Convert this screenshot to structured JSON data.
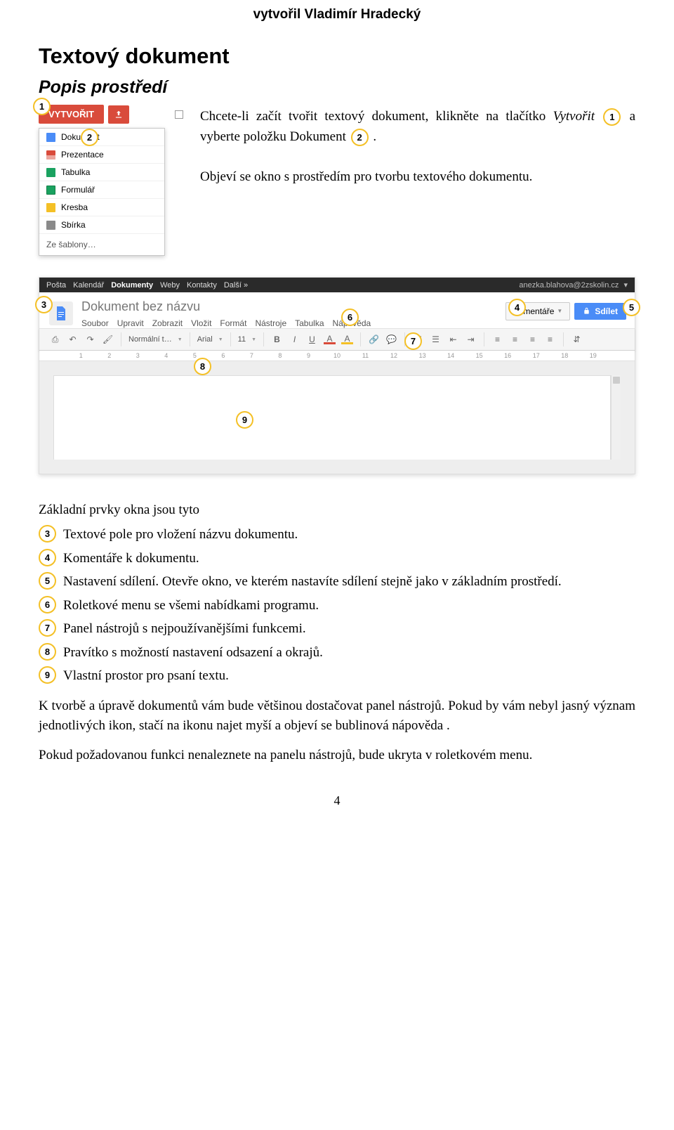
{
  "author": "vytvořil Vladimír Hradecký",
  "title": "Textový dokument",
  "subtitle": "Popis prostředí",
  "intro": {
    "line1_a": "Chcete-li začít tvořit textový dokument, klikněte na tlačítko",
    "vytvorit_word": "Vytvořit",
    "line1_b": " a vyberte položku Dokument ",
    "period": ".",
    "line2": "Objeví se okno s prostředím pro tvorbu textového dokumentu."
  },
  "markers": {
    "intro_left": "1",
    "intro_inline1": "1",
    "intro_inline2": "2",
    "create_item": "2",
    "docs_title": "3",
    "docs_comments": "4",
    "docs_share": "5",
    "docs_menu": "6",
    "docs_toolbar": "7",
    "docs_ruler": "8",
    "docs_body": "9"
  },
  "create_menu": {
    "button": "VYTVOŘIT",
    "items": [
      {
        "label": "Dokument",
        "icon": "ci-doc"
      },
      {
        "label": "Prezentace",
        "icon": "ci-pres"
      },
      {
        "label": "Tabulka",
        "icon": "ci-tab"
      },
      {
        "label": "Formulář",
        "icon": "ci-form"
      },
      {
        "label": "Kresba",
        "icon": "ci-draw"
      },
      {
        "label": "Sbírka",
        "icon": "ci-coll"
      }
    ],
    "from_template": "Ze šablony…"
  },
  "docs": {
    "blackbar": {
      "items": [
        "Pošta",
        "Kalendář",
        "Dokumenty",
        "Weby",
        "Kontakty",
        "Další »"
      ],
      "bold_index": 2,
      "user": "anezka.blahova@2zskolin.cz",
      "arrow": "▾"
    },
    "untitled": "Dokument bez názvu",
    "menubar": [
      "Soubor",
      "Upravit",
      "Zobrazit",
      "Vložit",
      "Formát",
      "Nástroje",
      "Tabulka",
      "Nápověda"
    ],
    "comments_btn": "Komentáře",
    "share_btn": "Sdílet",
    "toolbar": {
      "style": "Normální t…",
      "font": "Arial",
      "size": "11"
    },
    "ruler_max": 19
  },
  "legend": {
    "intro": "Základní prvky okna jsou tyto",
    "items": [
      {
        "num": "3",
        "text": "Textové pole pro vložení názvu dokumentu."
      },
      {
        "num": "4",
        "text": "Komentáře k dokumentu."
      },
      {
        "num": "5",
        "text": "Nastavení sdílení. Otevře okno, ve kterém nastavíte sdílení stejně jako v základním prostředí."
      },
      {
        "num": "6",
        "text": "Roletkové menu se všemi nabídkami programu."
      },
      {
        "num": "7",
        "text": "Panel nástrojů s nejpoužívanějšími funkcemi."
      },
      {
        "num": "8",
        "text": "Pravítko s možností nastavení odsazení a okrajů."
      },
      {
        "num": "9",
        "text": "Vlastní prostor pro psaní textu."
      }
    ]
  },
  "para1": "K tvorbě a úpravě dokumentů vám bude většinou dostačovat panel nástrojů. Pokud by vám nebyl jasný význam jednotlivých ikon, stačí na ikonu najet myší a objeví se bublinová nápověda .",
  "para2": "Pokud požadovanou funkci nenaleznete na panelu nástrojů, bude ukryta v roletkovém menu.",
  "pagenum": "4"
}
